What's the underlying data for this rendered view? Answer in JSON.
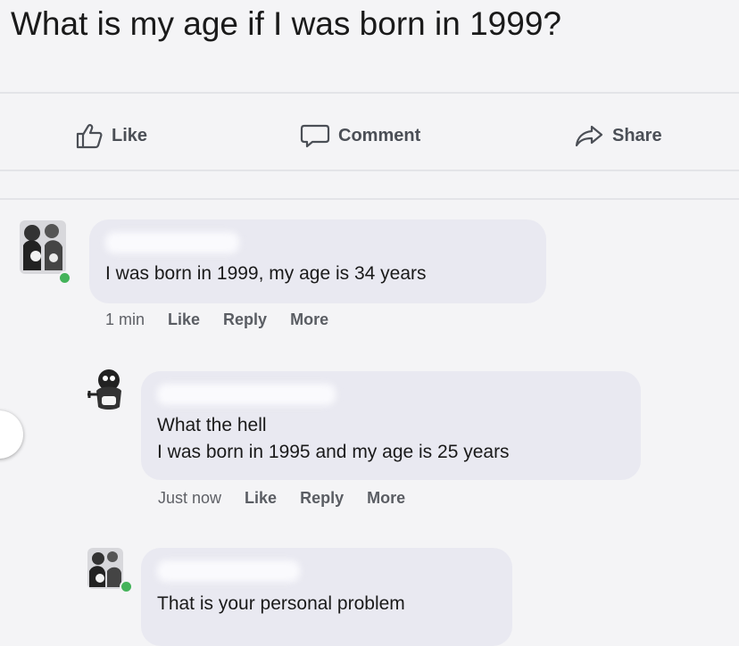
{
  "post": {
    "question": "What is my age if I was born in 1999?"
  },
  "actions": {
    "like": "Like",
    "comment": "Comment",
    "share": "Share"
  },
  "comments": [
    {
      "text_lines": [
        "I was born in 1999, my age is 34 years"
      ],
      "time": "1 min",
      "like": "Like",
      "reply": "Reply",
      "more": "More"
    },
    {
      "text_lines": [
        "What the hell",
        "I was born in 1995 and my age is 25 years"
      ],
      "time": "Just now",
      "like": "Like",
      "reply": "Reply",
      "more": "More"
    },
    {
      "text_lines": [
        "That is your personal problem"
      ]
    }
  ],
  "colors": {
    "background": "#f4f4f6",
    "bubble": "#e9e9f1",
    "online": "#44b35a",
    "action_text": "#4b4f56"
  }
}
